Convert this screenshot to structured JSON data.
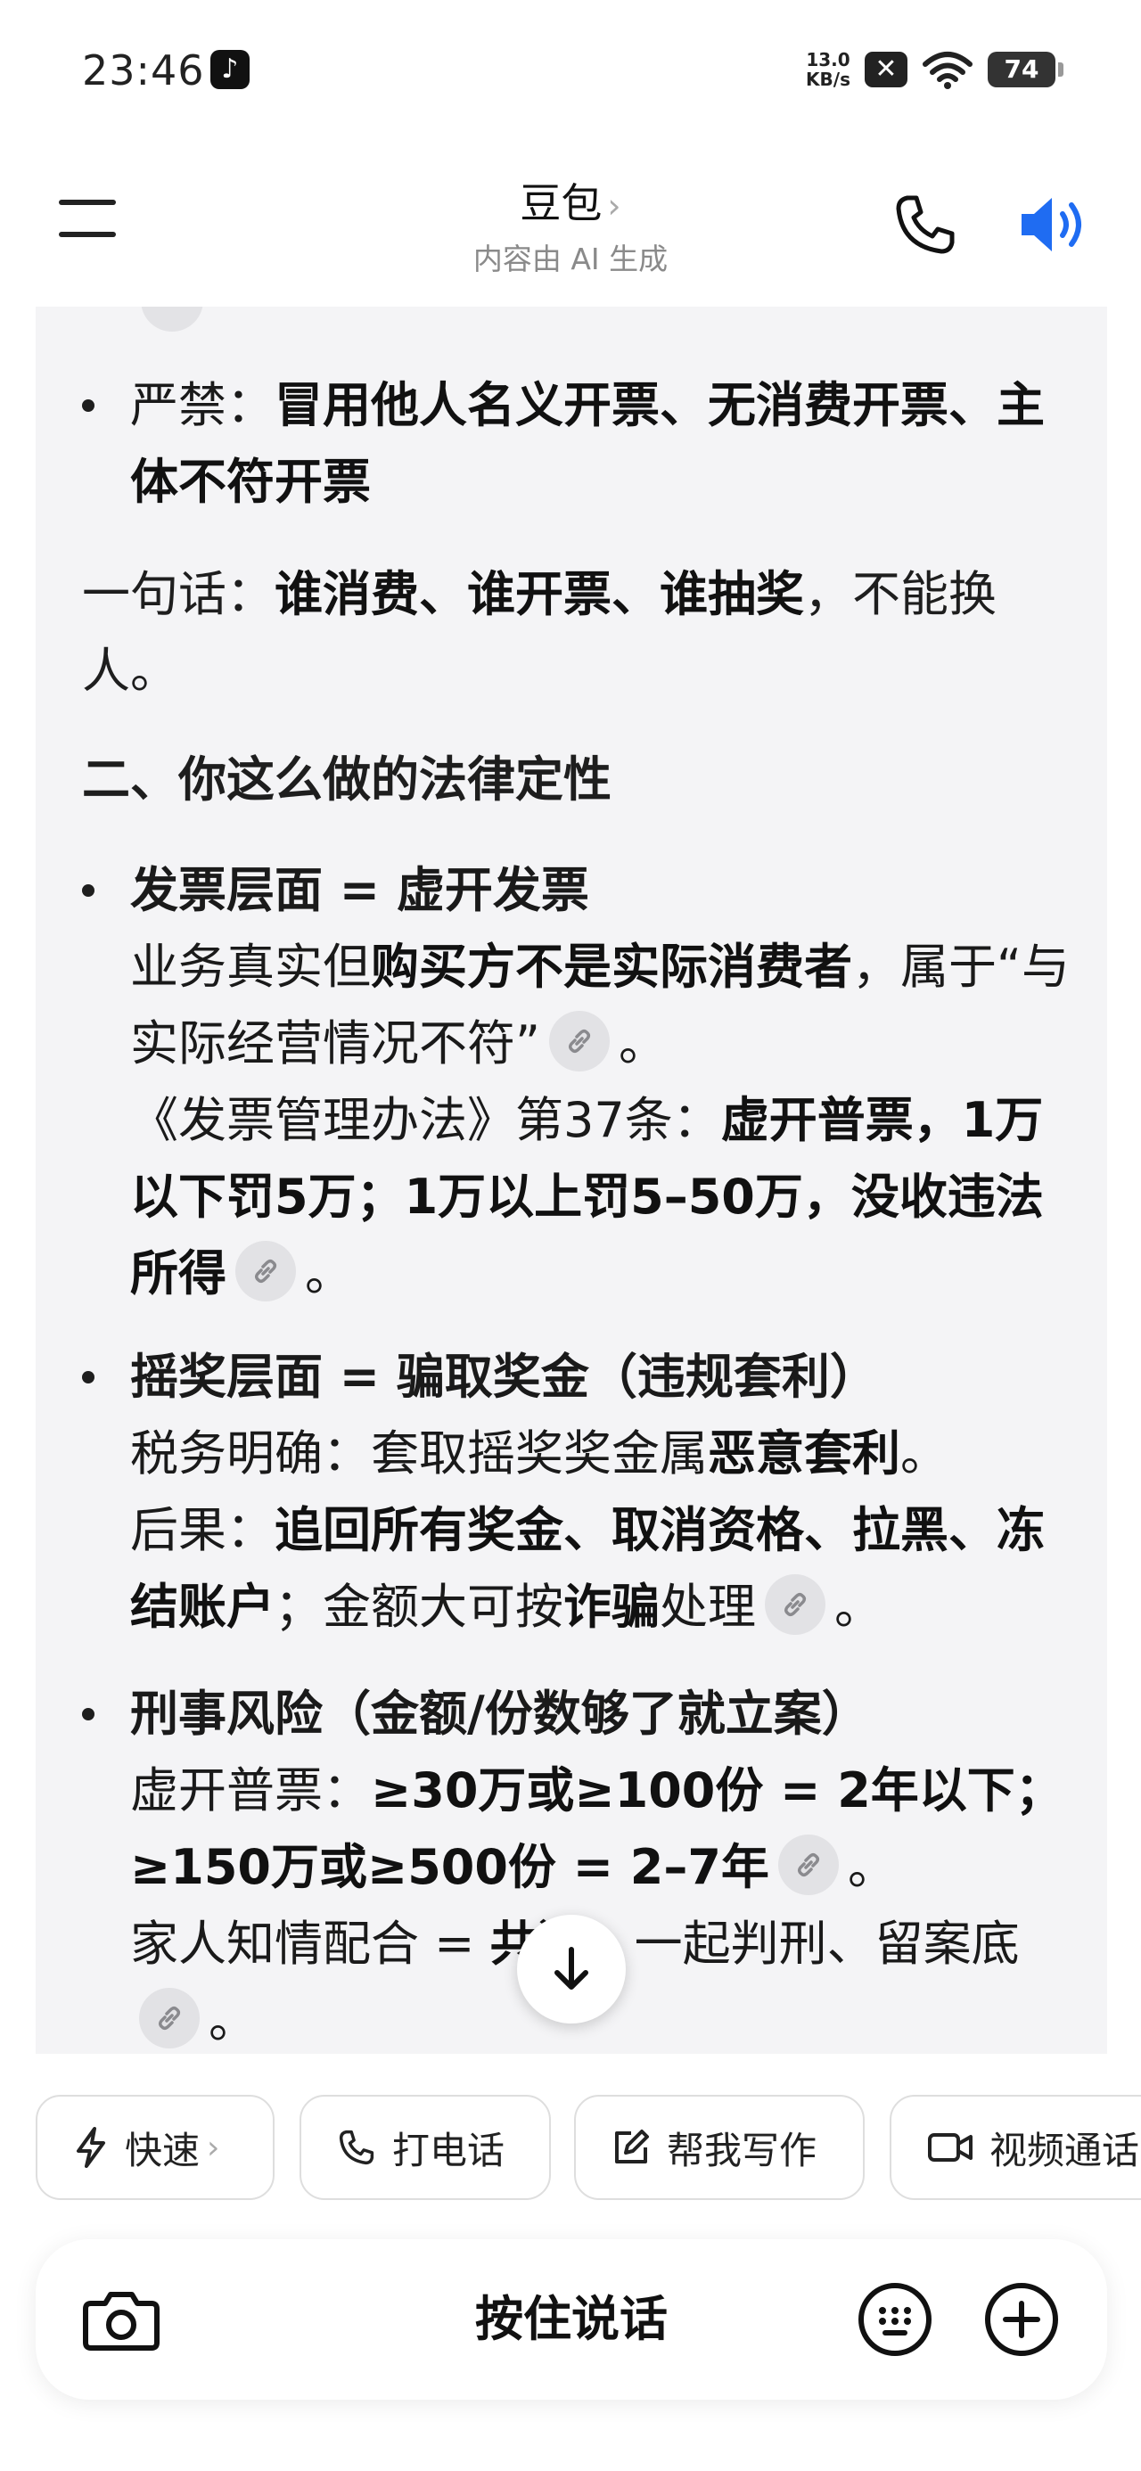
{
  "status_bar": {
    "time": "23:46",
    "app_icon_glyph": "♪",
    "net_speed_value": "13.0",
    "net_speed_unit": "KB/s",
    "x_badge": "✕",
    "battery": "74"
  },
  "header": {
    "title": "豆包",
    "title_chevron": "›",
    "subtitle": "内容由 AI 生成"
  },
  "content": {
    "strict": {
      "label": "严禁：",
      "bold": "冒用他人名义开票、无消费开票、主体不符开票"
    },
    "summary": {
      "prefix": "一句话：",
      "bold": "谁消费、谁开票、谁抽奖",
      "suffix": "，不能换人。"
    },
    "section2_heading": "二、你这么做的法律定性",
    "invoice": {
      "heading": "发票层面 = 虚开发票",
      "line1_prefix": "业务真实但",
      "line1_bold": "购买方不是实际消费者",
      "line1_suffix": "，属于“与实际经营情况不符”",
      "line1_end": "。",
      "line2_prefix": "《发票管理办法》第37条：",
      "line2_bold": "虚开普票，1万以下罚5万；1万以上罚5–50万，没收违法所得",
      "line2_end": "。"
    },
    "lottery": {
      "heading": "摇奖层面 = 骗取奖金（违规套利）",
      "line1_prefix": "税务明确：套取摇奖奖金属",
      "line1_bold": "恶意套利",
      "line1_end": "。",
      "line2_prefix": "后果：",
      "line2_bold": "追回所有奖金、取消资格、拉黑、冻结账户",
      "line2_mid": "；金额大可按",
      "line2_bold2": "诈骗",
      "line2_suffix": "处理",
      "line2_end": "。"
    },
    "criminal": {
      "heading": "刑事风险（金额/份数够了就立案）",
      "line1_prefix": "虚开普票：",
      "line1_bold": "≥30万或≥100份 = 2年以下；≥150万或≥500份 = 2–7年",
      "line1_end": "。",
      "line2_prefix": "家人知情配合 = ",
      "line2_bold": "共犯",
      "line2_suffix": "，一起判刑、留案底",
      "line2_end": "。"
    }
  },
  "chips": [
    {
      "label": "快速",
      "icon": "lightning-icon",
      "chevron": "›"
    },
    {
      "label": "打电话",
      "icon": "phone-icon"
    },
    {
      "label": "帮我写作",
      "icon": "edit-icon"
    },
    {
      "label": "视频通话",
      "icon": "video-icon"
    }
  ],
  "input_bar": {
    "hold_to_talk": "按住说话"
  }
}
